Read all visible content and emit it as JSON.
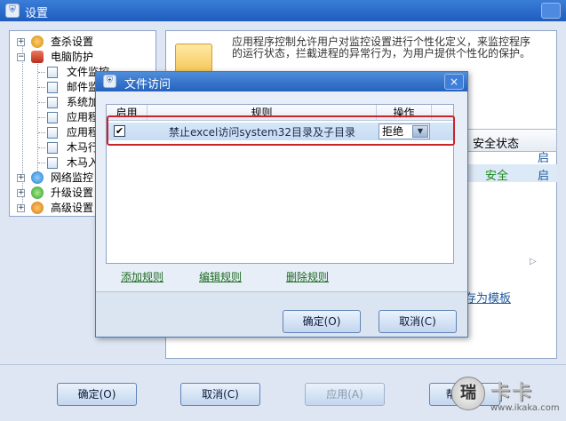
{
  "window": {
    "title": "设置"
  },
  "tree": {
    "items": [
      {
        "label": "查杀设置"
      },
      {
        "label": "电脑防护"
      },
      {
        "label": "文件监控"
      },
      {
        "label": "邮件监"
      },
      {
        "label": "系统加"
      },
      {
        "label": "应用程"
      },
      {
        "label": "应用程"
      },
      {
        "label": "木马行"
      },
      {
        "label": "木马入"
      },
      {
        "label": "网络监控"
      },
      {
        "label": "升级设置"
      },
      {
        "label": "高级设置"
      }
    ]
  },
  "right_panel": {
    "description": "应用程序控制允许用户对监控设置进行个性化定义，来监控程序的运行状态，拦截进程的异常行为，为用户提供个性化的保护。",
    "column_header": "安全状态",
    "fragment_1": "启",
    "fragment_2": "安全",
    "fragment_3": "启",
    "save_template": "存为模板"
  },
  "dialog": {
    "title": "文件访问",
    "close": "×",
    "columns": {
      "enable": "启用",
      "rule": "规则",
      "action": "操作"
    },
    "rows": [
      {
        "checked": "✔",
        "rule": "禁止excel访问system32目录及子目录",
        "action": "拒绝"
      }
    ],
    "add_rule": "添加规则",
    "edit_rule": "编辑规则",
    "delete_rule": "删除规则",
    "ok": "确定(O)",
    "cancel": "取消(C)"
  },
  "bottom": {
    "ok": "确定(O)",
    "cancel": "取消(C)",
    "apply": "应用(A)",
    "help": "帮助(H)"
  },
  "watermark": {
    "brand": "卡卡",
    "url": "www.ikaka.com"
  }
}
